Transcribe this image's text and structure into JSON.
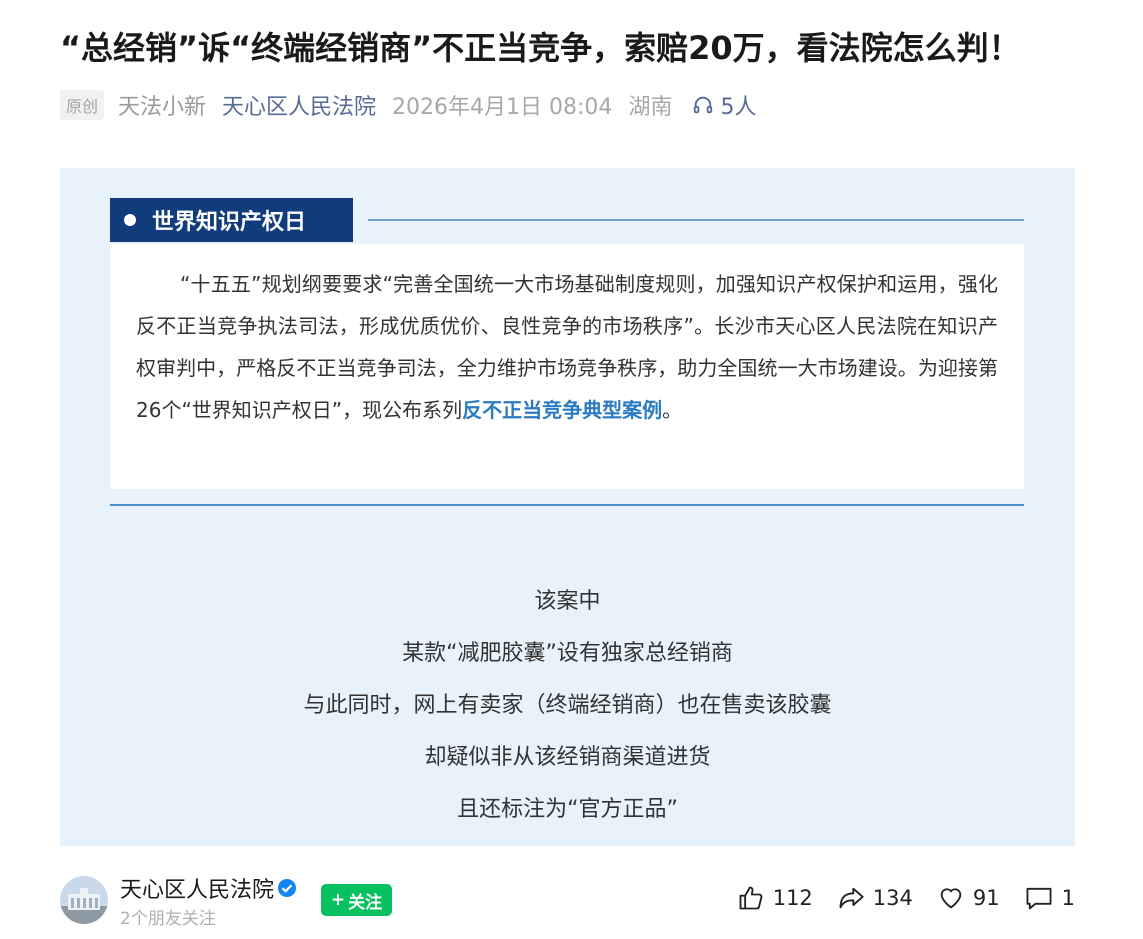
{
  "article": {
    "title": "“总经销”诉“终端经销商”不正当竞争，索赔20万，看法院怎么判！",
    "original_tag": "原创",
    "author": "天法小新",
    "account": "天心区人民法院",
    "datetime": "2026年4月1日 08:04",
    "region": "湖南",
    "listeners": "5人"
  },
  "section": {
    "label": "世界知识产权日"
  },
  "intro": {
    "text": "“十五五”规划纲要要求“完善全国统一大市场基础制度规则，加强知识产权保护和运用，强化反不正当竞争执法司法，形成优质优价、良性竞争的市场秩序”。长沙市天心区人民法院在知识产权审判中，严格反不正当竞争司法，全力维护市场竞争秩序，助力全国统一大市场建设。为迎接第26个“世界知识产权日”，现公布系列",
    "highlight": "反不正当竞争典型案例",
    "ending": "。"
  },
  "case_lines": [
    "该案中",
    "某款“减肥胶囊”设有独家总经销商",
    "与此同时，网上有卖家（终端经销商）也在售卖该胶囊",
    "却疑似非从该经销商渠道进货",
    "且还标注为“官方正品”"
  ],
  "footer": {
    "account_name": "天心区人民法院",
    "friends_following": "2个朋友关注",
    "follow_label": "关注",
    "likes": "112",
    "shares": "134",
    "favorites": "91",
    "comments": "1"
  },
  "colors": {
    "accent_link": "#576b95",
    "section_tag_bg": "#103c7c",
    "panel_bg": "#e7f2fb",
    "highlight": "#2b7bc3",
    "follow_button": "#07c160",
    "verified_badge": "#1485ee"
  },
  "icons": {
    "listen": "headphones-icon",
    "verified": "verified-badge-icon",
    "like": "thumbs-up-icon",
    "share": "share-icon",
    "favorite": "heart-icon",
    "comment": "comment-icon"
  }
}
